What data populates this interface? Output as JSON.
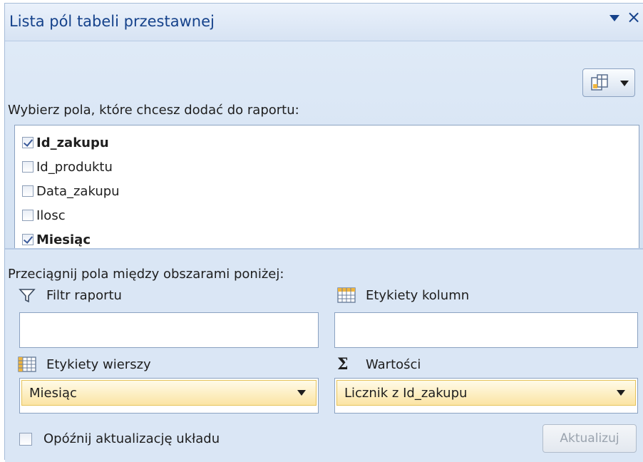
{
  "panel": {
    "title": "Lista pól tabeli przestawnej",
    "title_menu_icon": "dropdown-triangle-icon",
    "close_icon": "close-icon",
    "close_glyph": "×"
  },
  "fields_section": {
    "label": "Wybierz pola, które chcesz dodać do raportu:",
    "layout_button_icon": "field-list-layout-icon",
    "fields": [
      {
        "name": "Id_zakupu",
        "checked": true
      },
      {
        "name": "Id_produktu",
        "checked": false
      },
      {
        "name": "Data_zakupu",
        "checked": false
      },
      {
        "name": "Ilosc",
        "checked": false
      },
      {
        "name": "Miesiąc",
        "checked": true
      }
    ]
  },
  "areas_section": {
    "label": "Przeciągnij pola między obszarami poniżej:",
    "report_filter": {
      "label": "Filtr raportu",
      "icon": "filter-icon",
      "items": []
    },
    "column_labels": {
      "label": "Etykiety kolumn",
      "icon": "column-labels-icon",
      "items": []
    },
    "row_labels": {
      "label": "Etykiety wierszy",
      "icon": "row-labels-icon",
      "items": [
        "Miesiąc"
      ]
    },
    "values": {
      "label": "Wartości",
      "icon": "sigma-icon",
      "symbol": "Σ",
      "items": [
        "Licznik z Id_zakupu"
      ]
    }
  },
  "footer": {
    "defer_label": "Opóźnij aktualizację układu",
    "defer_checked": false,
    "update_button": "Aktualizuj",
    "update_enabled": false
  },
  "colors": {
    "title_text": "#15428b",
    "panel_bg": "#d7e4f4",
    "field_item_bg": "#fbe4a4"
  }
}
